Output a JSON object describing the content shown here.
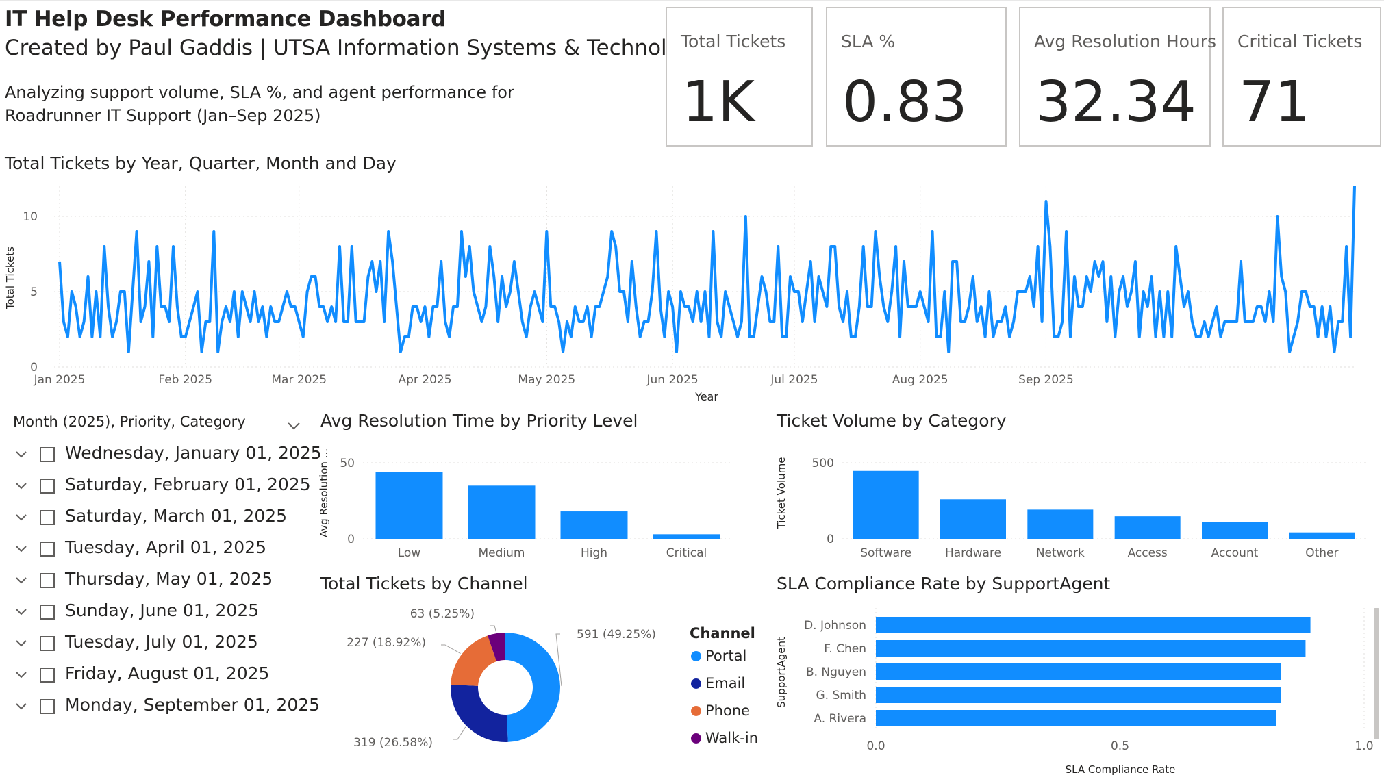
{
  "header": {
    "title": "IT Help Desk Performance Dashboard",
    "subtitle": "Created by Paul Gaddis | UTSA Information Systems & Technology",
    "description": "Analyzing support volume, SLA %, and agent performance for Roadrunner IT Support (Jan–Sep 2025)"
  },
  "kpis": [
    {
      "label": "Total Tickets",
      "value": "1K"
    },
    {
      "label": "SLA %",
      "value": "0.83"
    },
    {
      "label": "Avg Resolution Hours",
      "value": "32.34"
    },
    {
      "label": "Critical Tickets",
      "value": "71"
    }
  ],
  "slicer": {
    "header": "Month (2025), Priority, Category",
    "items": [
      "Wednesday, January 01, 2025",
      "Saturday, February 01, 2025",
      "Saturday, March 01, 2025",
      "Tuesday, April 01, 2025",
      "Thursday, May 01, 2025",
      "Sunday, June 01, 2025",
      "Tuesday, July 01, 2025",
      "Friday, August 01, 2025",
      "Monday, September 01, 2025"
    ]
  },
  "colors": {
    "primary": "#118DFF",
    "portal": "#118DFF",
    "email": "#12239E",
    "phone": "#E66C37",
    "walkin": "#6B007B",
    "axis": "#605e5c",
    "grid": "#e1dfdd"
  },
  "chart_data": [
    {
      "type": "line",
      "title": "Total Tickets by Year, Quarter, Month and Day",
      "xlabel": "Year",
      "ylabel": "Total Tickets",
      "ylim": [
        0,
        12
      ],
      "yticks": [
        "0",
        "5",
        "10"
      ],
      "xticks": [
        "Jan 2025",
        "Feb 2025",
        "Mar 2025",
        "Apr 2025",
        "May 2025",
        "Jun 2025",
        "Jul 2025",
        "Aug 2025",
        "Sep 2025"
      ],
      "x_start": "2025-01-01",
      "series": [
        {
          "values": [
            7,
            3,
            2,
            5,
            4,
            2,
            3,
            6,
            2,
            5,
            2,
            8,
            4,
            2,
            3,
            5,
            5,
            1,
            5,
            9,
            3,
            4,
            7,
            2,
            8,
            4,
            4,
            3,
            8,
            4,
            2,
            2,
            3,
            4,
            5,
            1,
            3,
            3,
            9,
            1,
            3,
            4,
            3,
            5,
            2,
            5,
            4,
            3,
            5,
            3,
            4,
            2,
            4,
            3,
            3,
            4,
            5,
            4,
            4,
            3,
            2,
            5,
            6,
            6,
            4,
            4,
            3,
            4,
            3,
            8,
            3,
            3,
            8,
            3,
            3,
            3,
            6,
            7,
            5,
            7,
            3,
            9,
            7,
            4,
            1,
            2,
            2,
            4,
            4,
            3,
            4,
            2,
            4,
            4,
            7,
            3,
            2,
            4,
            4,
            9,
            6,
            8,
            5,
            4,
            3,
            4,
            8,
            6,
            3,
            6,
            4,
            5,
            7,
            5,
            3,
            2,
            4,
            5,
            4,
            3,
            9,
            4,
            4,
            3,
            1,
            3,
            2,
            4,
            3,
            3,
            4,
            2,
            4,
            4,
            5,
            6,
            9,
            8,
            5,
            5,
            3,
            7,
            4,
            2,
            3,
            3,
            5,
            9,
            4,
            2,
            5,
            4,
            1,
            5,
            4,
            4,
            3,
            5,
            3,
            5,
            2,
            9,
            3,
            2,
            5,
            4,
            3,
            2,
            3,
            10,
            2,
            2,
            4,
            6,
            5,
            3,
            3,
            8,
            2,
            2,
            6,
            5,
            5,
            3,
            5,
            7,
            3,
            6,
            5,
            4,
            8,
            8,
            4,
            3,
            5,
            2,
            2,
            4,
            8,
            4,
            4,
            9,
            6,
            4,
            3,
            5,
            8,
            2,
            7,
            4,
            4,
            4,
            5,
            4,
            3,
            9,
            2,
            2,
            5,
            1,
            7,
            7,
            3,
            3,
            4,
            6,
            3,
            4,
            2,
            5,
            2,
            3,
            3,
            4,
            2,
            3,
            5,
            5,
            5,
            6,
            4,
            8,
            3,
            11,
            8,
            2,
            2,
            3,
            9,
            2,
            6,
            4,
            4,
            6,
            5,
            7,
            6,
            7,
            3,
            6,
            2,
            5,
            6,
            4,
            5,
            7,
            2,
            5,
            4,
            6,
            2,
            5,
            2,
            5,
            2,
            8,
            6,
            4,
            5,
            3,
            2,
            2,
            3,
            2,
            3,
            4,
            2,
            3,
            3,
            3,
            3,
            7,
            3,
            3,
            3,
            4,
            4,
            3,
            5,
            3,
            10,
            6,
            5,
            1,
            2,
            3,
            5,
            5,
            4,
            4,
            2,
            4,
            2,
            4,
            1,
            3,
            3,
            8,
            2,
            12
          ]
        }
      ]
    },
    {
      "type": "bar",
      "title": "Avg Resolution Time by Priority Level",
      "xlabel": "",
      "ylabel": "Avg Resolution ...",
      "categories": [
        "Low",
        "Medium",
        "High",
        "Critical"
      ],
      "values": [
        44,
        35,
        18,
        3
      ],
      "ylim": [
        0,
        50
      ],
      "yticks": [
        "0",
        "50"
      ]
    },
    {
      "type": "bar",
      "title": "Ticket Volume by Category",
      "xlabel": "",
      "ylabel": "Ticket Volume",
      "categories": [
        "Software",
        "Hardware",
        "Network",
        "Access",
        "Account",
        "Other"
      ],
      "values": [
        447,
        260,
        192,
        148,
        112,
        42
      ],
      "ylim": [
        0,
        500
      ],
      "yticks": [
        "0",
        "500"
      ]
    },
    {
      "type": "pie",
      "title": "Total Tickets by Channel",
      "legend_title": "Channel",
      "legend_position": "right",
      "categories": [
        "Portal",
        "Email",
        "Phone",
        "Walk-in"
      ],
      "values": [
        591,
        319,
        227,
        63
      ],
      "labels": [
        "591 (49.25%)",
        "319 (26.58%)",
        "227 (18.92%)",
        "63 (5.25%)"
      ]
    },
    {
      "type": "bar",
      "orientation": "horizontal",
      "title": "SLA Compliance Rate by SupportAgent",
      "xlabel": "SLA Compliance Rate",
      "ylabel": "SupportAgent",
      "categories": [
        "D. Johnson",
        "F. Chen",
        "B. Nguyen",
        "G. Smith",
        "A. Rivera"
      ],
      "values": [
        0.89,
        0.88,
        0.83,
        0.83,
        0.82
      ],
      "xlim": [
        0,
        1
      ],
      "xticks": [
        "0.0",
        "0.5",
        "1.0"
      ]
    }
  ]
}
